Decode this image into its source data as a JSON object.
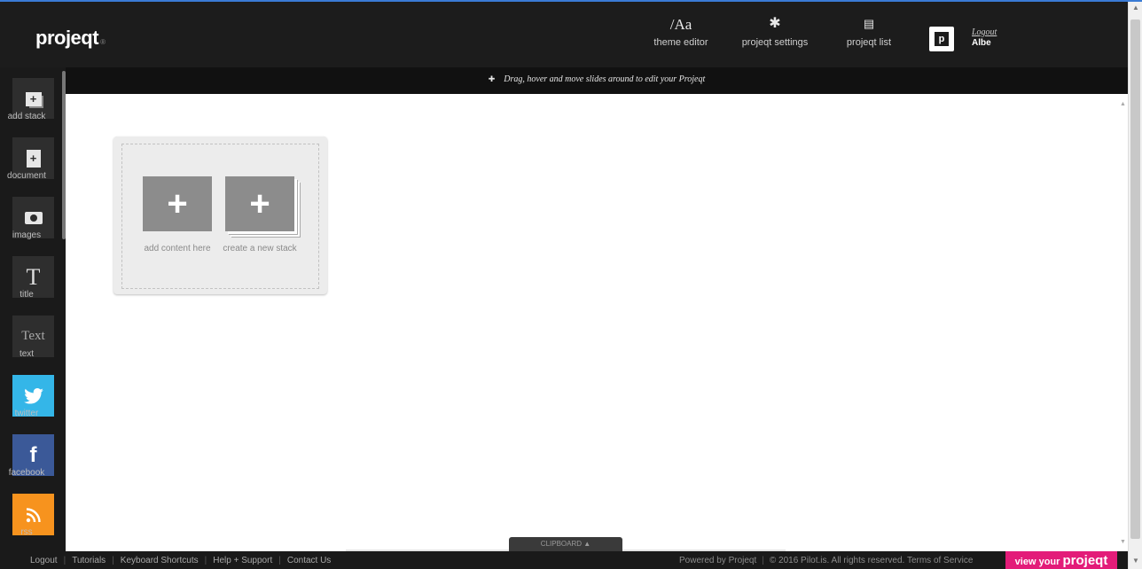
{
  "header": {
    "logo": "projeqt",
    "nav": {
      "theme_editor": "theme editor",
      "projeqt_settings": "projeqt settings",
      "projeqt_list": "projeqt list"
    },
    "theme_icon_text": "Aa",
    "avatar_letter": "p",
    "logout": "Logout",
    "username": "Albe"
  },
  "hint": "Drag, hover and move slides around to edit your Projeqt",
  "sidebar": {
    "items": [
      {
        "label": "add stack",
        "icon": "add-stack-icon"
      },
      {
        "label": "document",
        "icon": "document-icon"
      },
      {
        "label": "images",
        "icon": "camera-icon"
      },
      {
        "label": "title",
        "icon": "title-icon",
        "glyph": "T"
      },
      {
        "label": "text",
        "icon": "text-icon",
        "glyph": "Text"
      },
      {
        "label": "twitter",
        "icon": "twitter-icon",
        "color": "#34b6e8"
      },
      {
        "label": "facebook",
        "icon": "facebook-icon",
        "glyph": "f",
        "color": "#3b5998"
      },
      {
        "label": "rss",
        "icon": "rss-icon",
        "color": "#f7931e"
      }
    ]
  },
  "stack": {
    "add_content": "add content here",
    "new_stack": "create a new stack"
  },
  "clipboard": "CLIPBOARD",
  "footer": {
    "links": [
      "Logout",
      "Tutorials",
      "Keyboard Shortcuts",
      "Help + Support",
      "Contact Us"
    ],
    "powered": "Powered by Projeqt",
    "copyright": "© 2016 Pilot.is. All rights reserved.",
    "terms": "Terms of Service",
    "view_prefix": "view your",
    "view_brand": "projeqt"
  },
  "colors": {
    "accent": "#e31c79",
    "header_bg": "#1c1c1c",
    "twitter": "#34b6e8",
    "facebook": "#3b5998",
    "rss": "#f7931e"
  }
}
